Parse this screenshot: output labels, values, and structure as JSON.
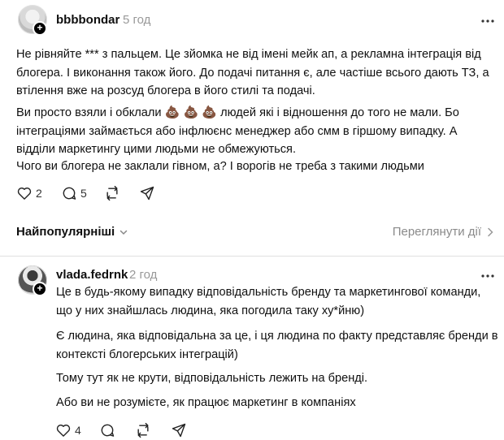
{
  "post": {
    "username": "bbbbondar",
    "time": "5 год",
    "paragraphs": [
      "Не рівняйте *** з пальцем. Це зйомка не від імені мейк ап, а рекламна інтеграція від блогера. І виконання також його. До подачі питання є, але частіше всього дають ТЗ, а втілення вже на розсуд блогера в його стилі та подачі."
    ],
    "p2_before": "Ви просто взяли і обклали ",
    "p2_emoji": "💩 💩 💩",
    "p2_after": " людей які і відношення до того не мали. Бо інтеграціями займається або інфлюєнс менеджер або смм в гіршому випадку. А відділи маркетингу цими людьми не обмежуються.",
    "p3": "Чого ви блогера не заклали гівном, а? І ворогів не треба з такими людьми",
    "likes": "2",
    "replies": "5"
  },
  "section": {
    "sort_label": "Найпопулярніші",
    "view_all": "Переглянути дії"
  },
  "comment": {
    "username": "vlada.fedrnk",
    "time": "2 год",
    "paragraphs": [
      "Це в будь-якому випадку відповідальність бренду та маркетингової команди, що у них знайшлась людина, яка погодила таку ху*йню)",
      "Є людина, яка відповідальна за це, і ця людина по факту представляє бренди в контексті блогерських інтеграцій)",
      "Тому тут як не крути, відповідальність лежить на бренді.",
      "Або ви не розумієте, як працює маркетинг в компаніях"
    ],
    "likes": "4"
  },
  "icons": [
    "heart-icon",
    "comment-icon",
    "repost-icon",
    "share-icon",
    "more-icon",
    "chevron-down-icon",
    "chevron-right-icon",
    "plus-icon"
  ]
}
